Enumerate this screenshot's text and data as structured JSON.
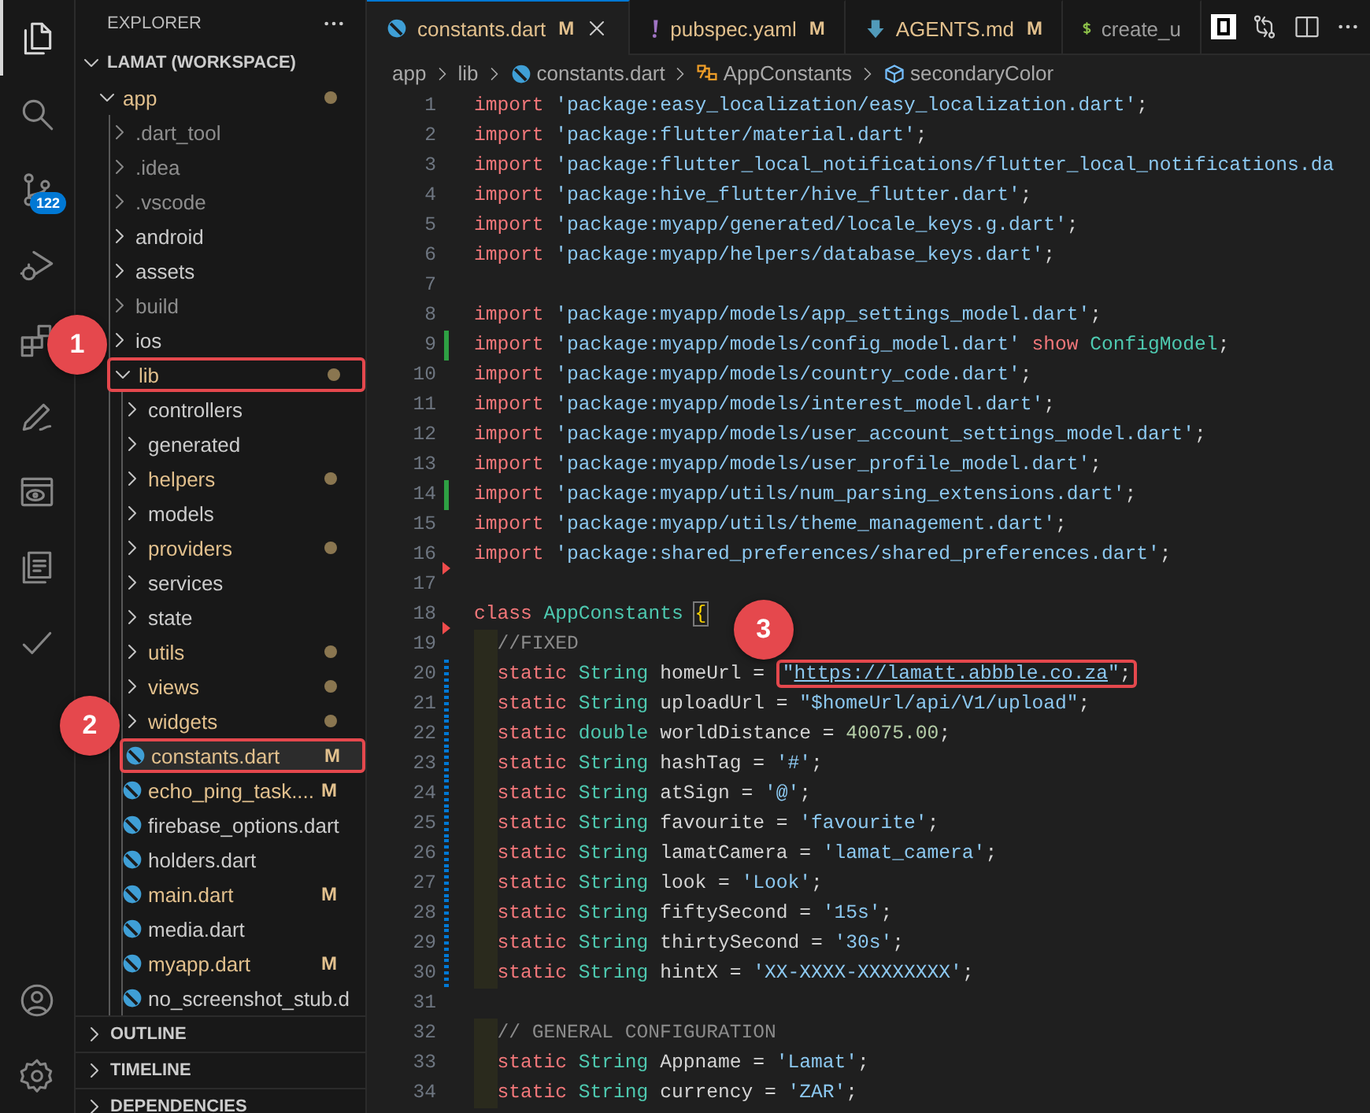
{
  "activity_bar": {
    "items": [
      {
        "kind": "files",
        "selected": true
      },
      {
        "kind": "search",
        "selected": false
      },
      {
        "kind": "source-control",
        "selected": false,
        "badge": "122"
      },
      {
        "kind": "run-debug",
        "selected": false
      },
      {
        "kind": "extensions",
        "selected": false
      },
      {
        "kind": "pencil",
        "selected": false
      },
      {
        "kind": "preview",
        "selected": false
      },
      {
        "kind": "book",
        "selected": false
      },
      {
        "kind": "check",
        "selected": false
      }
    ],
    "bottom": [
      {
        "kind": "account"
      },
      {
        "kind": "settings"
      }
    ]
  },
  "explorer": {
    "title": "EXPLORER",
    "tree": [
      {
        "label": "LAMAT (WORKSPACE)",
        "kind": "workspace",
        "expanded": true,
        "modified": false,
        "ignored": false,
        "dot": false,
        "selected": false,
        "outlined": false,
        "children": [
          {
            "label": "app",
            "kind": "folder",
            "expanded": true,
            "modified": true,
            "ignored": false,
            "dot": true,
            "selected": false,
            "outlined": false,
            "children": [
              {
                "label": ".dart_tool",
                "kind": "folder",
                "expanded": false,
                "modified": false,
                "ignored": true,
                "dot": false,
                "selected": false,
                "outlined": false
              },
              {
                "label": ".idea",
                "kind": "folder",
                "expanded": false,
                "modified": false,
                "ignored": true,
                "dot": false,
                "selected": false,
                "outlined": false
              },
              {
                "label": ".vscode",
                "kind": "folder",
                "expanded": false,
                "modified": false,
                "ignored": true,
                "dot": false,
                "selected": false,
                "outlined": false
              },
              {
                "label": "android",
                "kind": "folder",
                "expanded": false,
                "modified": false,
                "ignored": false,
                "dot": false,
                "selected": false,
                "outlined": false
              },
              {
                "label": "assets",
                "kind": "folder",
                "expanded": false,
                "modified": false,
                "ignored": false,
                "dot": false,
                "selected": false,
                "outlined": false
              },
              {
                "label": "build",
                "kind": "folder",
                "expanded": false,
                "modified": false,
                "ignored": true,
                "dot": false,
                "selected": false,
                "outlined": false
              },
              {
                "label": "ios",
                "kind": "folder",
                "expanded": false,
                "modified": false,
                "ignored": false,
                "dot": false,
                "selected": false,
                "outlined": false
              },
              {
                "label": "lib",
                "kind": "folder",
                "expanded": true,
                "modified": true,
                "ignored": false,
                "dot": true,
                "selected": false,
                "outlined": true,
                "callout": "1",
                "children": [
                  {
                    "label": "controllers",
                    "kind": "folder",
                    "expanded": false,
                    "modified": false,
                    "ignored": false,
                    "dot": false,
                    "selected": false,
                    "outlined": false
                  },
                  {
                    "label": "generated",
                    "kind": "folder",
                    "expanded": false,
                    "modified": false,
                    "ignored": false,
                    "dot": false,
                    "selected": false,
                    "outlined": false
                  },
                  {
                    "label": "helpers",
                    "kind": "folder",
                    "expanded": false,
                    "modified": true,
                    "ignored": false,
                    "dot": true,
                    "selected": false,
                    "outlined": false
                  },
                  {
                    "label": "models",
                    "kind": "folder",
                    "expanded": false,
                    "modified": false,
                    "ignored": false,
                    "dot": false,
                    "selected": false,
                    "outlined": false
                  },
                  {
                    "label": "providers",
                    "kind": "folder",
                    "expanded": false,
                    "modified": true,
                    "ignored": false,
                    "dot": true,
                    "selected": false,
                    "outlined": false
                  },
                  {
                    "label": "services",
                    "kind": "folder",
                    "expanded": false,
                    "modified": false,
                    "ignored": false,
                    "dot": false,
                    "selected": false,
                    "outlined": false
                  },
                  {
                    "label": "state",
                    "kind": "folder",
                    "expanded": false,
                    "modified": false,
                    "ignored": false,
                    "dot": false,
                    "selected": false,
                    "outlined": false
                  },
                  {
                    "label": "utils",
                    "kind": "folder",
                    "expanded": false,
                    "modified": true,
                    "ignored": false,
                    "dot": true,
                    "selected": false,
                    "outlined": false
                  },
                  {
                    "label": "views",
                    "kind": "folder",
                    "expanded": false,
                    "modified": true,
                    "ignored": false,
                    "dot": true,
                    "selected": false,
                    "outlined": false
                  },
                  {
                    "label": "widgets",
                    "kind": "folder",
                    "expanded": false,
                    "modified": true,
                    "ignored": false,
                    "dot": true,
                    "selected": false,
                    "outlined": false
                  },
                  {
                    "label": "constants.dart",
                    "kind": "file",
                    "modified": true,
                    "ignored": false,
                    "badge": "M",
                    "dot": false,
                    "selected": true,
                    "outlined": true,
                    "callout": "2"
                  },
                  {
                    "label": "echo_ping_task....",
                    "kind": "file",
                    "modified": true,
                    "ignored": false,
                    "badge": "M",
                    "dot": false,
                    "selected": false,
                    "outlined": false
                  },
                  {
                    "label": "firebase_options.dart",
                    "kind": "file",
                    "modified": false,
                    "ignored": false,
                    "dot": false,
                    "selected": false,
                    "outlined": false
                  },
                  {
                    "label": "holders.dart",
                    "kind": "file",
                    "modified": false,
                    "ignored": false,
                    "dot": false,
                    "selected": false,
                    "outlined": false
                  },
                  {
                    "label": "main.dart",
                    "kind": "file",
                    "modified": true,
                    "ignored": false,
                    "badge": "M",
                    "dot": false,
                    "selected": false,
                    "outlined": false
                  },
                  {
                    "label": "media.dart",
                    "kind": "file",
                    "modified": false,
                    "ignored": false,
                    "dot": false,
                    "selected": false,
                    "outlined": false
                  },
                  {
                    "label": "myapp.dart",
                    "kind": "file",
                    "modified": true,
                    "ignored": false,
                    "badge": "M",
                    "dot": false,
                    "selected": false,
                    "outlined": false
                  },
                  {
                    "label": "no_screenshot_stub.d",
                    "kind": "file",
                    "modified": false,
                    "ignored": false,
                    "dot": false,
                    "selected": false,
                    "outlined": false
                  }
                ]
              }
            ]
          }
        ]
      }
    ],
    "sections": [
      {
        "label": "OUTLINE",
        "expanded": false
      },
      {
        "label": "TIMELINE",
        "expanded": false
      },
      {
        "label": "DEPENDENCIES",
        "expanded": false
      }
    ]
  },
  "tabs": [
    {
      "label": "constants.dart",
      "kind": "dart",
      "badge": "M",
      "modified": true,
      "selected": true
    },
    {
      "label": "pubspec.yaml",
      "kind": "yaml",
      "badge": "M",
      "modified": true,
      "selected": false
    },
    {
      "label": "AGENTS.md",
      "kind": "markdown",
      "badge": "M",
      "modified": true,
      "selected": false
    },
    {
      "label": "create_u",
      "kind": "shell",
      "modified": false,
      "selected": false
    }
  ],
  "breadcrumb": [
    {
      "label": "app"
    },
    {
      "label": "lib"
    },
    {
      "label": "constants.dart",
      "kind": "dart"
    },
    {
      "label": "AppConstants",
      "kind": "class"
    },
    {
      "label": "secondaryColor",
      "kind": "field"
    }
  ],
  "editor": {
    "lines": [
      {
        "number": "1",
        "added": false,
        "changed": false,
        "deleted": false,
        "indent": false,
        "tokens": [
          {
            "kind": "kw",
            "text": "import "
          },
          {
            "kind": "str",
            "text": "'package:easy_localization/easy_localization.dart'"
          },
          {
            "kind": "txt",
            "text": ";"
          }
        ]
      },
      {
        "number": "2",
        "added": false,
        "changed": false,
        "deleted": false,
        "indent": false,
        "tokens": [
          {
            "kind": "kw",
            "text": "import "
          },
          {
            "kind": "str",
            "text": "'package:flutter/material.dart'"
          },
          {
            "kind": "txt",
            "text": ";"
          }
        ]
      },
      {
        "number": "3",
        "added": false,
        "changed": false,
        "deleted": false,
        "indent": false,
        "tokens": [
          {
            "kind": "kw",
            "text": "import "
          },
          {
            "kind": "str",
            "text": "'package:flutter_local_notifications/flutter_local_notifications.da"
          }
        ]
      },
      {
        "number": "4",
        "added": false,
        "changed": false,
        "deleted": false,
        "indent": false,
        "tokens": [
          {
            "kind": "kw",
            "text": "import "
          },
          {
            "kind": "str",
            "text": "'package:hive_flutter/hive_flutter.dart'"
          },
          {
            "kind": "txt",
            "text": ";"
          }
        ]
      },
      {
        "number": "5",
        "added": false,
        "changed": false,
        "deleted": false,
        "indent": false,
        "tokens": [
          {
            "kind": "kw",
            "text": "import "
          },
          {
            "kind": "str",
            "text": "'package:myapp/generated/locale_keys.g.dart'"
          },
          {
            "kind": "txt",
            "text": ";"
          }
        ]
      },
      {
        "number": "6",
        "added": false,
        "changed": false,
        "deleted": false,
        "indent": false,
        "tokens": [
          {
            "kind": "kw",
            "text": "import "
          },
          {
            "kind": "str",
            "text": "'package:myapp/helpers/database_keys.dart'"
          },
          {
            "kind": "txt",
            "text": ";"
          }
        ]
      },
      {
        "number": "7",
        "added": false,
        "changed": false,
        "deleted": false
      },
      {
        "number": "8",
        "added": false,
        "changed": false,
        "deleted": false,
        "indent": false,
        "tokens": [
          {
            "kind": "kw",
            "text": "import "
          },
          {
            "kind": "str",
            "text": "'package:myapp/models/app_settings_model.dart'"
          },
          {
            "kind": "txt",
            "text": ";"
          }
        ]
      },
      {
        "number": "9",
        "added": true,
        "changed": false,
        "deleted": false,
        "indent": false,
        "tokens": [
          {
            "kind": "kw",
            "text": "import "
          },
          {
            "kind": "str",
            "text": "'package:myapp/models/config_model.dart' "
          },
          {
            "kind": "kw",
            "text": "show "
          },
          {
            "kind": "type",
            "text": "ConfigModel"
          },
          {
            "kind": "txt",
            "text": ";"
          }
        ]
      },
      {
        "number": "10",
        "added": false,
        "changed": false,
        "deleted": false,
        "indent": false,
        "tokens": [
          {
            "kind": "kw",
            "text": "import "
          },
          {
            "kind": "str",
            "text": "'package:myapp/models/country_code.dart'"
          },
          {
            "kind": "txt",
            "text": ";"
          }
        ]
      },
      {
        "number": "11",
        "added": false,
        "changed": false,
        "deleted": false,
        "indent": false,
        "tokens": [
          {
            "kind": "kw",
            "text": "import "
          },
          {
            "kind": "str",
            "text": "'package:myapp/models/interest_model.dart'"
          },
          {
            "kind": "txt",
            "text": ";"
          }
        ]
      },
      {
        "number": "12",
        "added": false,
        "changed": false,
        "deleted": false,
        "indent": false,
        "tokens": [
          {
            "kind": "kw",
            "text": "import "
          },
          {
            "kind": "str",
            "text": "'package:myapp/models/user_account_settings_model.dart'"
          },
          {
            "kind": "txt",
            "text": ";"
          }
        ]
      },
      {
        "number": "13",
        "added": false,
        "changed": false,
        "deleted": false,
        "indent": false,
        "tokens": [
          {
            "kind": "kw",
            "text": "import "
          },
          {
            "kind": "str",
            "text": "'package:myapp/models/user_profile_model.dart'"
          },
          {
            "kind": "txt",
            "text": ";"
          }
        ]
      },
      {
        "number": "14",
        "added": true,
        "changed": false,
        "deleted": false,
        "indent": false,
        "tokens": [
          {
            "kind": "kw",
            "text": "import "
          },
          {
            "kind": "str",
            "text": "'package:myapp/utils/num_parsing_extensions.dart'"
          },
          {
            "kind": "txt",
            "text": ";"
          }
        ]
      },
      {
        "number": "15",
        "added": false,
        "changed": false,
        "deleted": false,
        "indent": false,
        "tokens": [
          {
            "kind": "kw",
            "text": "import "
          },
          {
            "kind": "str",
            "text": "'package:myapp/utils/theme_management.dart'"
          },
          {
            "kind": "txt",
            "text": ";"
          }
        ]
      },
      {
        "number": "16",
        "added": false,
        "changed": false,
        "deleted": true,
        "indent": false,
        "tokens": [
          {
            "kind": "kw",
            "text": "import "
          },
          {
            "kind": "str",
            "text": "'package:shared_preferences/shared_preferences.dart'"
          },
          {
            "kind": "txt",
            "text": ";"
          }
        ]
      },
      {
        "number": "17",
        "added": false,
        "changed": false,
        "deleted": false
      },
      {
        "number": "18",
        "added": false,
        "changed": false,
        "deleted": true,
        "indent": false,
        "tokens": [
          {
            "kind": "kw",
            "text": "class "
          },
          {
            "kind": "type",
            "text": "AppConstants "
          },
          {
            "kind": "brace",
            "text": "{"
          }
        ]
      },
      {
        "number": "19",
        "added": false,
        "changed": false,
        "deleted": false,
        "indent": true,
        "tokens": [
          {
            "kind": "com",
            "text": "//FIXED"
          }
        ]
      },
      {
        "number": "20",
        "added": false,
        "changed": true,
        "deleted": false,
        "indent": true,
        "tokens": [
          {
            "kind": "kw",
            "text": "static "
          },
          {
            "kind": "type",
            "text": "String "
          },
          {
            "kind": "txt",
            "text": "homeUrl = "
          }
        ],
        "boxed_tokens": [
          {
            "kind": "str",
            "text": "\""
          },
          {
            "kind": "link",
            "text": "https://lamatt.abbble.co.za"
          },
          {
            "kind": "str",
            "text": "\""
          },
          {
            "kind": "txt",
            "text": ";"
          }
        ],
        "callout": "3"
      },
      {
        "number": "21",
        "added": false,
        "changed": true,
        "deleted": false,
        "indent": true,
        "tokens": [
          {
            "kind": "kw",
            "text": "static "
          },
          {
            "kind": "type",
            "text": "String "
          },
          {
            "kind": "txt",
            "text": "uploadUrl = "
          },
          {
            "kind": "str",
            "text": "\"$homeUrl/api/V1/upload\""
          },
          {
            "kind": "txt",
            "text": ";"
          }
        ]
      },
      {
        "number": "22",
        "added": false,
        "changed": true,
        "deleted": false,
        "indent": true,
        "tokens": [
          {
            "kind": "kw",
            "text": "static "
          },
          {
            "kind": "type",
            "text": "double "
          },
          {
            "kind": "txt",
            "text": "worldDistance = "
          },
          {
            "kind": "num",
            "text": "40075.00"
          },
          {
            "kind": "txt",
            "text": ";"
          }
        ]
      },
      {
        "number": "23",
        "added": false,
        "changed": true,
        "deleted": false,
        "indent": true,
        "tokens": [
          {
            "kind": "kw",
            "text": "static "
          },
          {
            "kind": "type",
            "text": "String "
          },
          {
            "kind": "txt",
            "text": "hashTag = "
          },
          {
            "kind": "str",
            "text": "'#'"
          },
          {
            "kind": "txt",
            "text": ";"
          }
        ]
      },
      {
        "number": "24",
        "added": false,
        "changed": true,
        "deleted": false,
        "indent": true,
        "tokens": [
          {
            "kind": "kw",
            "text": "static "
          },
          {
            "kind": "type",
            "text": "String "
          },
          {
            "kind": "txt",
            "text": "atSign = "
          },
          {
            "kind": "str",
            "text": "'@'"
          },
          {
            "kind": "txt",
            "text": ";"
          }
        ]
      },
      {
        "number": "25",
        "added": false,
        "changed": true,
        "deleted": false,
        "indent": true,
        "tokens": [
          {
            "kind": "kw",
            "text": "static "
          },
          {
            "kind": "type",
            "text": "String "
          },
          {
            "kind": "txt",
            "text": "favourite = "
          },
          {
            "kind": "str",
            "text": "'favourite'"
          },
          {
            "kind": "txt",
            "text": ";"
          }
        ]
      },
      {
        "number": "26",
        "added": false,
        "changed": true,
        "deleted": false,
        "indent": true,
        "tokens": [
          {
            "kind": "kw",
            "text": "static "
          },
          {
            "kind": "type",
            "text": "String "
          },
          {
            "kind": "txt",
            "text": "lamatCamera = "
          },
          {
            "kind": "str",
            "text": "'lamat_camera'"
          },
          {
            "kind": "txt",
            "text": ";"
          }
        ]
      },
      {
        "number": "27",
        "added": false,
        "changed": true,
        "deleted": false,
        "indent": true,
        "tokens": [
          {
            "kind": "kw",
            "text": "static "
          },
          {
            "kind": "type",
            "text": "String "
          },
          {
            "kind": "txt",
            "text": "look = "
          },
          {
            "kind": "str",
            "text": "'Look'"
          },
          {
            "kind": "txt",
            "text": ";"
          }
        ]
      },
      {
        "number": "28",
        "added": false,
        "changed": true,
        "deleted": false,
        "indent": true,
        "tokens": [
          {
            "kind": "kw",
            "text": "static "
          },
          {
            "kind": "type",
            "text": "String "
          },
          {
            "kind": "txt",
            "text": "fiftySecond = "
          },
          {
            "kind": "str",
            "text": "'15s'"
          },
          {
            "kind": "txt",
            "text": ";"
          }
        ]
      },
      {
        "number": "29",
        "added": false,
        "changed": true,
        "deleted": false,
        "indent": true,
        "tokens": [
          {
            "kind": "kw",
            "text": "static "
          },
          {
            "kind": "type",
            "text": "String "
          },
          {
            "kind": "txt",
            "text": "thirtySecond = "
          },
          {
            "kind": "str",
            "text": "'30s'"
          },
          {
            "kind": "txt",
            "text": ";"
          }
        ]
      },
      {
        "number": "30",
        "added": false,
        "changed": true,
        "deleted": false,
        "indent": true,
        "tokens": [
          {
            "kind": "kw",
            "text": "static "
          },
          {
            "kind": "type",
            "text": "String "
          },
          {
            "kind": "txt",
            "text": "hintX = "
          },
          {
            "kind": "str",
            "text": "'XX-XXXX-XXXXXXXX'"
          },
          {
            "kind": "txt",
            "text": ";"
          }
        ]
      },
      {
        "number": "31",
        "added": false,
        "changed": false,
        "deleted": false
      },
      {
        "number": "32",
        "added": false,
        "changed": false,
        "deleted": false,
        "indent": true,
        "tokens": [
          {
            "kind": "com",
            "text": "// GENERAL CONFIGURATION"
          }
        ]
      },
      {
        "number": "33",
        "added": false,
        "changed": false,
        "deleted": false,
        "indent": true,
        "tokens": [
          {
            "kind": "kw",
            "text": "static "
          },
          {
            "kind": "type",
            "text": "String "
          },
          {
            "kind": "txt",
            "text": "Appname = "
          },
          {
            "kind": "str",
            "text": "'Lamat'"
          },
          {
            "kind": "txt",
            "text": ";"
          }
        ]
      },
      {
        "number": "34",
        "added": false,
        "changed": false,
        "deleted": false,
        "indent": true,
        "tokens": [
          {
            "kind": "kw",
            "text": "static "
          },
          {
            "kind": "type",
            "text": "String "
          },
          {
            "kind": "txt",
            "text": "currency = "
          },
          {
            "kind": "str",
            "text": "'ZAR'"
          },
          {
            "kind": "txt",
            "text": ";"
          }
        ]
      }
    ]
  }
}
